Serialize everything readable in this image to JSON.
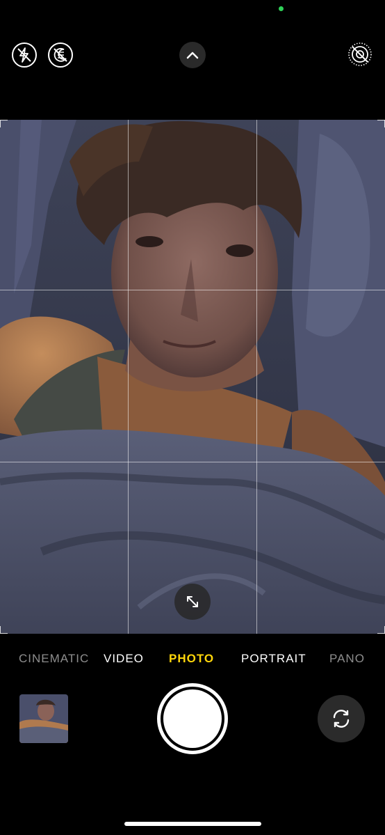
{
  "camera": {
    "modes": [
      "CINEMATIC",
      "VIDEO",
      "PHOTO",
      "PORTRAIT",
      "PANO"
    ],
    "active_mode": "PHOTO"
  },
  "icons": {
    "flash": "flash-off-icon",
    "night_mode": "night-mode-off-icon",
    "controls": "chevron-up-icon",
    "live_photo": "live-photo-off-icon",
    "zoom": "expand-arrows-icon",
    "flip": "flip-camera-icon"
  },
  "colors": {
    "active_mode": "#ffd60a",
    "privacy_indicator": "#2fd158",
    "background": "#000000"
  }
}
